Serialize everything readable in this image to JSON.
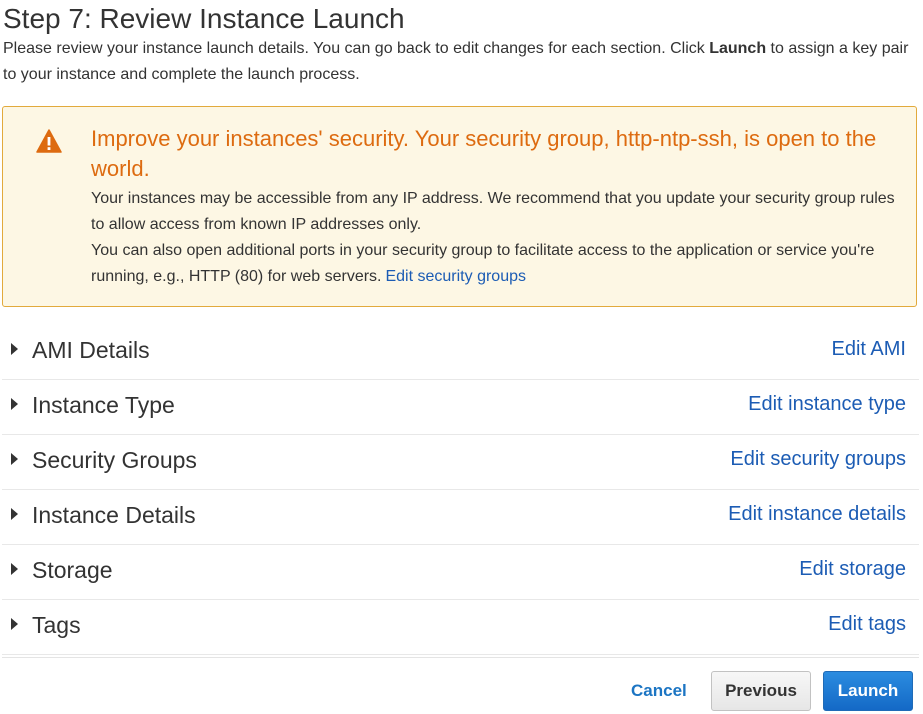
{
  "page": {
    "title": "Step 7: Review Instance Launch",
    "intro_before": "Please review your instance launch details. You can go back to edit changes for each section. Click ",
    "intro_bold": "Launch",
    "intro_after": " to assign a key pair to your instance and complete the launch process."
  },
  "alert": {
    "icon": "warning-icon",
    "title": "Improve your instances' security. Your security group, http-ntp-ssh, is open to the world.",
    "paragraph1": "Your instances may be accessible from any IP address. We recommend that you update your security group rules to allow access from known IP addresses only.",
    "paragraph2": "You can also open additional ports in your security group to facilitate access to the application or service you're running, e.g., HTTP (80) for web servers.",
    "link": "Edit security groups",
    "title_color": "#dd6b10",
    "border_color": "#e2aa3c",
    "background_color": "#fdf7e4"
  },
  "sections": [
    {
      "label": "AMI Details",
      "edit": "Edit AMI"
    },
    {
      "label": "Instance Type",
      "edit": "Edit instance type"
    },
    {
      "label": "Security Groups",
      "edit": "Edit security groups"
    },
    {
      "label": "Instance Details",
      "edit": "Edit instance details"
    },
    {
      "label": "Storage",
      "edit": "Edit storage"
    },
    {
      "label": "Tags",
      "edit": "Edit tags"
    }
  ],
  "footer": {
    "cancel": "Cancel",
    "previous": "Previous",
    "launch": "Launch",
    "link_color": "#1c5cb4",
    "primary_color": "#1b73cc"
  }
}
